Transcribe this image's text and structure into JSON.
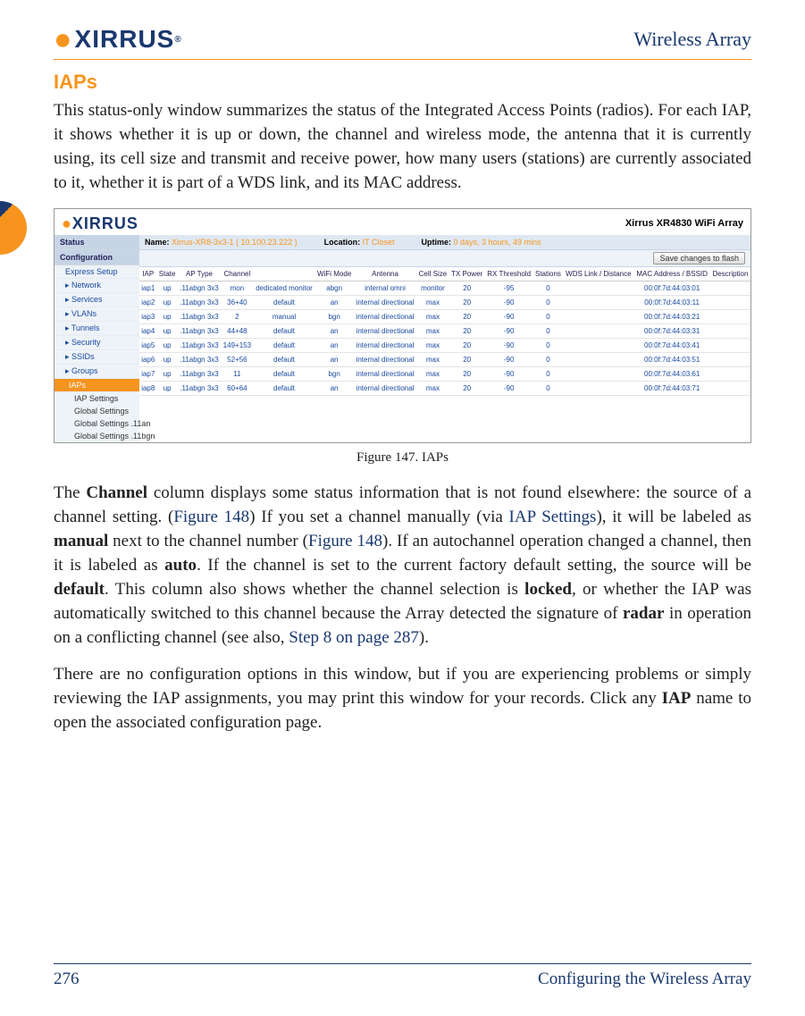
{
  "header": {
    "logo_text": "XIRRUS",
    "doc_title": "Wireless Array"
  },
  "section": {
    "heading": "IAPs",
    "intro": "This status-only window summarizes the status of the Integrated Access Points (radios). For each IAP, it shows whether it is up or down, the channel and wireless mode, the antenna that it is currently using, its cell size and transmit and receive power, how many users (stations) are currently associated to it, whether it is part of a WDS link, and its MAC address.",
    "figure_caption": "Figure 147. IAPs",
    "para2_pre": "The ",
    "para2_b1": "Channel",
    "para2_mid1": " column displays some status information that is not found elsewhere: the source of a channel setting. (",
    "para2_link1": "Figure 148",
    "para2_mid2": ") If you set a channel manually (via ",
    "para2_link2": "IAP Settings",
    "para2_mid3": "), it will be labeled as ",
    "para2_b2": "manual",
    "para2_mid4": " next to the channel number (",
    "para2_link3": "Figure 148",
    "para2_mid5": "). If an autochannel operation changed a channel, then it is labeled as ",
    "para2_b3": "auto",
    "para2_mid6": ". If the channel is set to the current factory default setting, the source will be ",
    "para2_b4": "default",
    "para2_mid7": ". This column also shows whether the channel selection is ",
    "para2_b5": "locked",
    "para2_mid8": ", or whether the IAP was automatically switched to this channel because the Array detected the signature of ",
    "para2_b6": "radar",
    "para2_mid9": " in operation on a conflicting channel (see also, ",
    "para2_link4": "Step 8 on page 287",
    "para2_end": ").",
    "para3_pre": "There are no configuration options in this window, but if you are experiencing problems or simply reviewing the IAP assignments, you may print this window for your records. Click any ",
    "para3_b1": "IAP",
    "para3_end": " name to open the associated configuration page."
  },
  "screenshot": {
    "logo": "XIRRUS",
    "model": "Xirrus XR4830 WiFi Array",
    "info": {
      "name_lbl": "Name:",
      "name_val": "Xirrus-XR8-3x3-1   ( 10.100.23.222 )",
      "loc_lbl": "Location:",
      "loc_val": "IT Closet",
      "uptime_lbl": "Uptime:",
      "uptime_val": "0 days, 3 hours, 49 mins"
    },
    "save_button": "Save changes to flash",
    "sidebar": {
      "status": "Status",
      "config": "Configuration",
      "items": [
        "Express Setup",
        "Network",
        "Services",
        "VLANs",
        "Tunnels",
        "Security",
        "SSIDs",
        "Groups"
      ],
      "active": "IAPs",
      "subs": [
        "IAP Settings",
        "Global Settings",
        "Global Settings .11an",
        "Global Settings .11bgn"
      ]
    },
    "table": {
      "cols": [
        "IAP",
        "State",
        "AP Type",
        "Channel",
        "",
        "WiFi Mode",
        "Antenna",
        "Cell Size",
        "TX Power",
        "RX Threshold",
        "Stations",
        "WDS Link / Distance",
        "MAC Address / BSSID",
        "Description"
      ],
      "rows": [
        [
          "iap1",
          "up",
          ".11abgn 3x3",
          "mon",
          "dedicated monitor",
          "abgn",
          "internal omni",
          "monitor",
          "20",
          "-95",
          "0",
          "",
          "00:0f:7d:44:03:01",
          ""
        ],
        [
          "iap2",
          "up",
          ".11abgn 3x3",
          "36+40",
          "default",
          "an",
          "internal directional",
          "max",
          "20",
          "-90",
          "0",
          "",
          "00:0f:7d:44:03:11",
          ""
        ],
        [
          "iap3",
          "up",
          ".11abgn 3x3",
          "2",
          "manual",
          "bgn",
          "internal directional",
          "max",
          "20",
          "-90",
          "0",
          "",
          "00:0f:7d:44:03:21",
          ""
        ],
        [
          "iap4",
          "up",
          ".11abgn 3x3",
          "44+48",
          "default",
          "an",
          "internal directional",
          "max",
          "20",
          "-90",
          "0",
          "",
          "00:0f:7d:44:03:31",
          ""
        ],
        [
          "iap5",
          "up",
          ".11abgn 3x3",
          "149+153",
          "default",
          "an",
          "internal directional",
          "max",
          "20",
          "-90",
          "0",
          "",
          "00:0f:7d:44:03:41",
          ""
        ],
        [
          "iap6",
          "up",
          ".11abgn 3x3",
          "52+56",
          "default",
          "an",
          "internal directional",
          "max",
          "20",
          "-90",
          "0",
          "",
          "00:0f:7d:44:03:51",
          ""
        ],
        [
          "iap7",
          "up",
          ".11abgn 3x3",
          "11",
          "default",
          "bgn",
          "internal directional",
          "max",
          "20",
          "-90",
          "0",
          "",
          "00:0f:7d:44:03:61",
          ""
        ],
        [
          "iap8",
          "up",
          ".11abgn 3x3",
          "60+64",
          "default",
          "an",
          "internal directional",
          "max",
          "20",
          "-90",
          "0",
          "",
          "00:0f:7d:44:03:71",
          ""
        ]
      ]
    }
  },
  "footer": {
    "page": "276",
    "section": "Configuring the Wireless Array"
  }
}
